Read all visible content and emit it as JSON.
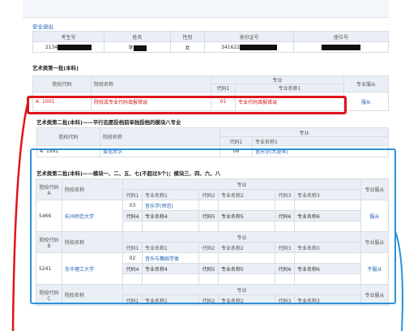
{
  "header": {
    "logout_label": "安全退出"
  },
  "student": {
    "columns": [
      "考生号",
      "姓名",
      "性别",
      "身份证号",
      "座位号"
    ],
    "values": {
      "exam_no": "2134",
      "name": "李",
      "gender": "女",
      "id_no": "341622",
      "seat_no": ""
    }
  },
  "batch1": {
    "title": "艺术类第一批(本科)",
    "cols": {
      "school_code": "院校代码",
      "school_name": "院校名称",
      "major": "专业",
      "major_code": "代码1",
      "major_name": "专业名称1",
      "obey": "专业服从"
    },
    "row": {
      "letter": "A",
      "code": "1001",
      "name": "院校或专业代码填报错误",
      "major_code": "01",
      "major_name": "专业代码填报错误",
      "obey": "服从"
    }
  },
  "batch2a": {
    "title": "艺术类第二批(本科)——平行志愿投档前单独投档的模块八专业",
    "cols": {
      "school_code": "院校代码",
      "school_name": "院校名称",
      "major": "专业",
      "major_code": "代码1",
      "major_name": "专业名称1"
    },
    "row": {
      "letter": "A",
      "code": "1991",
      "name": "青岛大学",
      "major_code": "06",
      "major_name": "音乐学(大提琴)"
    }
  },
  "batch2b": {
    "title": "艺术类第二批(本科)——模块一、二、五、七(不超过5个)；模块三、四、六、八",
    "cols": {
      "school_code": "院校代码",
      "school_name": "院校名称",
      "major": "专业",
      "obey": "专业服从"
    },
    "sub": [
      "代码1",
      "专业名称1",
      "代码2",
      "专业名称2",
      "代码3",
      "专业名称3"
    ],
    "sub2": [
      "代码4",
      "专业名称4",
      "代码5",
      "专业名称5",
      "代码6",
      "专业名称6"
    ],
    "groups": [
      {
        "letter": "A",
        "code": "5466",
        "name": "杭州师范大学",
        "major_code": "03",
        "major_name": "音乐学(师范)",
        "obey": "服从"
      },
      {
        "letter": "B",
        "code": "5241",
        "name": "东华理工大学",
        "major_code": "02",
        "major_name": "音乐与舞蹈学类",
        "obey": "不服从"
      },
      {
        "letter": "C",
        "code": "",
        "name": "",
        "major_code": "",
        "major_name": "",
        "obey": ""
      }
    ]
  },
  "colors": {
    "red_box": "#e0141c",
    "blue_box": "#2a92dd",
    "link": "#1d5fb0",
    "error": "#d21a1a"
  }
}
